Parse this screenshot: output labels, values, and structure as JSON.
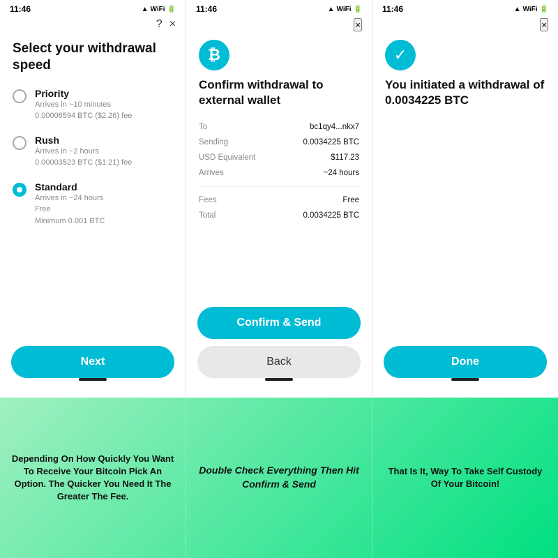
{
  "screens": [
    {
      "id": "screen1",
      "status_time": "11:46",
      "title": "Select your withdrawal speed",
      "close_label": "×",
      "help_label": "?",
      "options": [
        {
          "name": "Priority",
          "detail_line1": "Arrives in ~10 minutes",
          "detail_line2": "0.00006594 BTC ($2.26) fee",
          "selected": false
        },
        {
          "name": "Rush",
          "detail_line1": "Arrives in ~2 hours",
          "detail_line2": "0.00003523 BTC ($1.21) fee",
          "selected": false
        },
        {
          "name": "Standard",
          "detail_line1": "Arrives in ~24 hours",
          "detail_line2": "Free",
          "detail_line3": "Minimum 0.001 BTC",
          "selected": true
        }
      ],
      "next_label": "Next"
    },
    {
      "id": "screen2",
      "status_time": "11:46",
      "title": "Confirm withdrawal to external wallet",
      "close_label": "×",
      "btc_icon": "₿",
      "details": [
        {
          "label": "To",
          "value": "bc1qy4...nkx7"
        },
        {
          "label": "Sending",
          "value": "0.0034225 BTC"
        },
        {
          "label": "USD Equivalent",
          "value": "$117.23"
        },
        {
          "label": "Arrives",
          "value": "~24 hours"
        }
      ],
      "details2": [
        {
          "label": "Fees",
          "value": "Free"
        },
        {
          "label": "Total",
          "value": "0.0034225 BTC"
        }
      ],
      "confirm_label": "Confirm & Send",
      "back_label": "Back"
    },
    {
      "id": "screen3",
      "status_time": "11:46",
      "title": "You initiated a withdrawal of 0.0034225 BTC",
      "close_label": "×",
      "check_icon": "✓",
      "done_label": "Done"
    }
  ],
  "captions": [
    {
      "text": "Depending On How Quickly You Want To Receive Your Bitcoin Pick An Option. The Quicker You Need It The Greater The Fee."
    },
    {
      "text": "Double Check Everything Then Hit Confirm & Send"
    },
    {
      "text": "That Is It, Way To Take Self Custody Of Your Bitcoin!"
    }
  ]
}
